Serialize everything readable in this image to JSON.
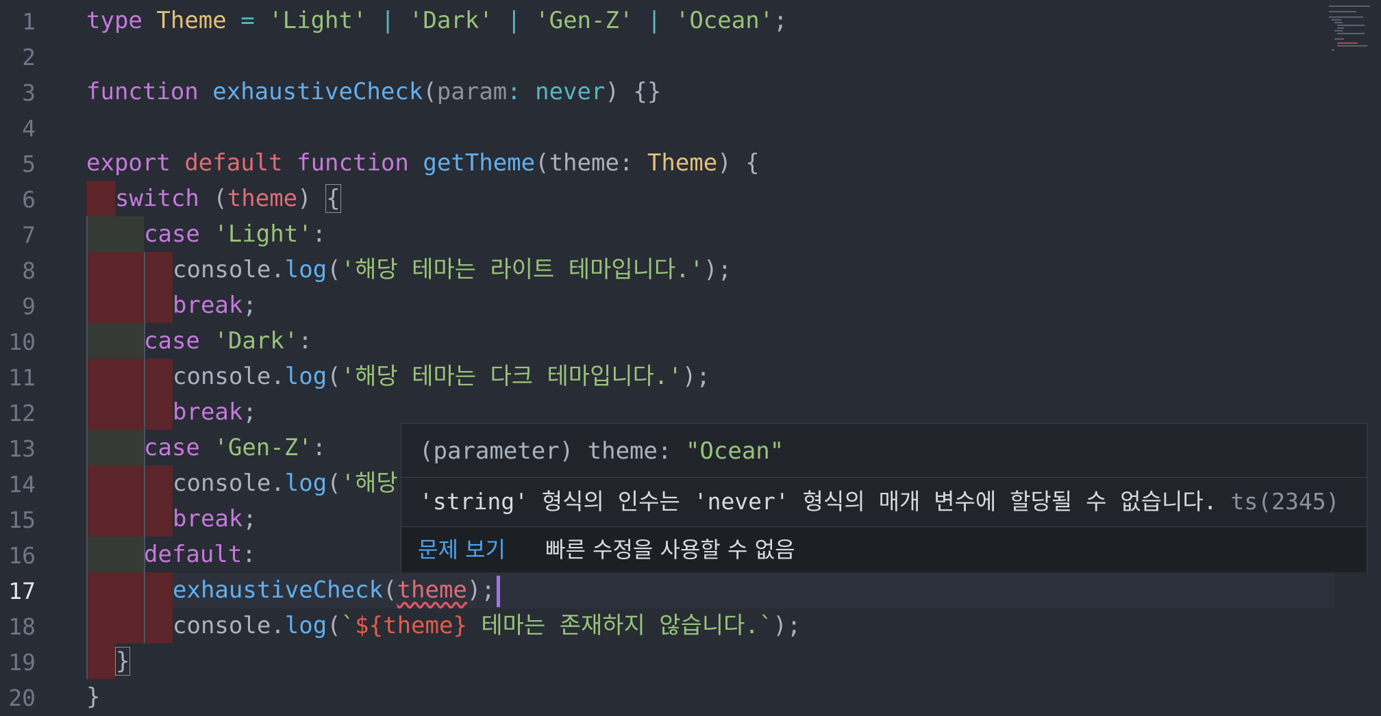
{
  "editor": {
    "active_line": "17",
    "line_numbers": [
      "1",
      "2",
      "3",
      "4",
      "5",
      "6",
      "7",
      "8",
      "9",
      "10",
      "11",
      "12",
      "13",
      "14",
      "15",
      "16",
      "17",
      "18",
      "19",
      "20"
    ],
    "code": {
      "l1": {
        "a": "type",
        "b": " ",
        "c": "Theme",
        "d": " = ",
        "e": "'Light'",
        "f": " | ",
        "g": "'Dark'",
        "h": " | ",
        "i": "'Gen-Z'",
        "j": " | ",
        "k": "'Ocean'",
        "l": ";"
      },
      "l3": {
        "a": "function",
        "b": " ",
        "c": "exhaustiveCheck",
        "d": "(",
        "e": "param",
        "f": ": ",
        "g": "never",
        "h": ") {}"
      },
      "l5": {
        "a": "export",
        "b": " ",
        "c": "default",
        "d": " ",
        "e": "function",
        "f": " ",
        "g": "getTheme",
        "h": "(theme: ",
        "i": "Theme",
        "j": ") {"
      },
      "l6": {
        "a": "switch",
        "b": " (",
        "c": "theme",
        "d": ") ",
        "e": "{"
      },
      "l7": {
        "a": "case",
        "b": " ",
        "c": "'Light'",
        "d": ":"
      },
      "l8": {
        "a": "console.",
        "b": "log",
        "c": "(",
        "d": "'해당 테마는 라이트 테마입니다.'",
        "e": ");"
      },
      "l9": {
        "a": "break",
        "b": ";"
      },
      "l10": {
        "a": "case",
        "b": " ",
        "c": "'Dark'",
        "d": ":"
      },
      "l11": {
        "a": "console.",
        "b": "log",
        "c": "(",
        "d": "'해당 테마는 다크 테마입니다.'",
        "e": ");"
      },
      "l12": {
        "a": "break",
        "b": ";"
      },
      "l13": {
        "a": "case",
        "b": " ",
        "c": "'Gen-Z'",
        "d": ":"
      },
      "l14": {
        "a": "console.",
        "b": "log",
        "c": "(",
        "d": "'해당"
      },
      "l15": {
        "a": "break",
        "b": ";"
      },
      "l16": {
        "a": "default",
        "b": ":"
      },
      "l17": {
        "a": "exhaustiveCheck",
        "b": "(",
        "c": "theme",
        "d": ");"
      },
      "l18": {
        "a": "console.",
        "b": "log",
        "c": "(",
        "d": "`",
        "e": "${theme}",
        "f": " 테마는 존재하지 않습니다.`",
        "g": ");"
      },
      "l19": {
        "a": "}"
      },
      "l20": {
        "a": "}"
      }
    }
  },
  "hover": {
    "signature_prefix": "(parameter) theme: ",
    "signature_type": "\"Ocean\"",
    "message": "'string' 형식의 인수는 'never' 형식의 매개 변수에 할당될 수 없습니다. ",
    "error_code": "ts(2345)",
    "view_problem": "문제 보기",
    "no_quick_fix": "빠른 수정을 사용할 수 없음"
  },
  "colors": {
    "background": "#282c34",
    "keyword": "#c678dd",
    "string": "#98c379",
    "function": "#61afef",
    "type": "#e5c07b",
    "error_underline": "#e05561",
    "link": "#4fa3f0"
  }
}
